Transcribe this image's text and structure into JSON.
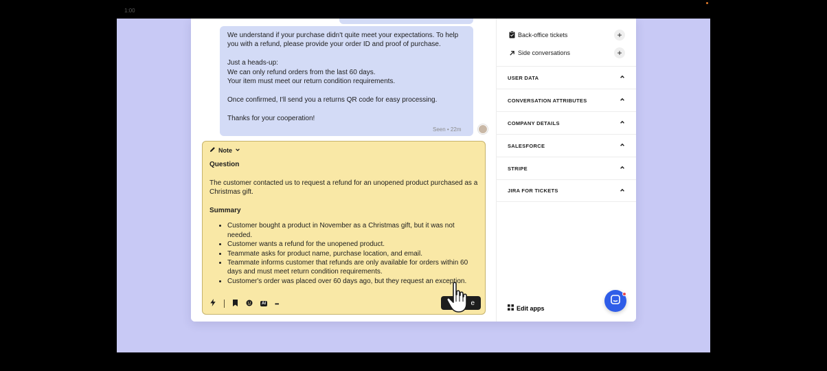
{
  "recording": {
    "timestamp": "1:00"
  },
  "conversation": {
    "message_lines": [
      "We understand if your purchase didn't quite meet your expectations. To help",
      "you with a refund, please provide your order ID and proof of purchase.",
      "",
      "Just a heads-up:",
      "We can only refund orders from the last 60 days.",
      "Your item must meet our return condition requirements.",
      "",
      "Once confirmed, I'll send you a returns QR code for easy processing.",
      "",
      "Thanks for your cooperation!"
    ],
    "seen_status": "Seen • 22m"
  },
  "note": {
    "mode_label": "Note",
    "question_heading": "Question",
    "question_lines": [
      "The customer contacted us to request a refund for an unopened product purchased as a",
      "Christmas gift."
    ],
    "summary_heading": "Summary",
    "summary_items": [
      "Customer bought a product in November as a Christmas gift, but it was not needed.",
      "Customer wants a refund for the unopened product.",
      "Teammate asks for product name, purchase location, and email.",
      "Teammate informs customer that refunds are only available for orders within 60 days and must meet return condition requirements.",
      "Customer's order was placed over 60 days ago, but they request an exception."
    ],
    "ai_badge": "AI",
    "more_label": "•••",
    "send_label": "e"
  },
  "sidebar": {
    "backoffice_label": "Back-office tickets",
    "side_conversations_label": "Side conversations",
    "sections": [
      "USER DATA",
      "CONVERSATION ATTRIBUTES",
      "COMPANY DETAILS",
      "SALESFORCE",
      "STRIPE",
      "JIRA FOR TICKETS"
    ],
    "edit_apps_label": "Edit apps"
  },
  "colors": {
    "stage": "#c8c9f5",
    "bubble": "#d3dbf6",
    "note": "#f9e8a6",
    "messenger": "#2f5de8"
  }
}
